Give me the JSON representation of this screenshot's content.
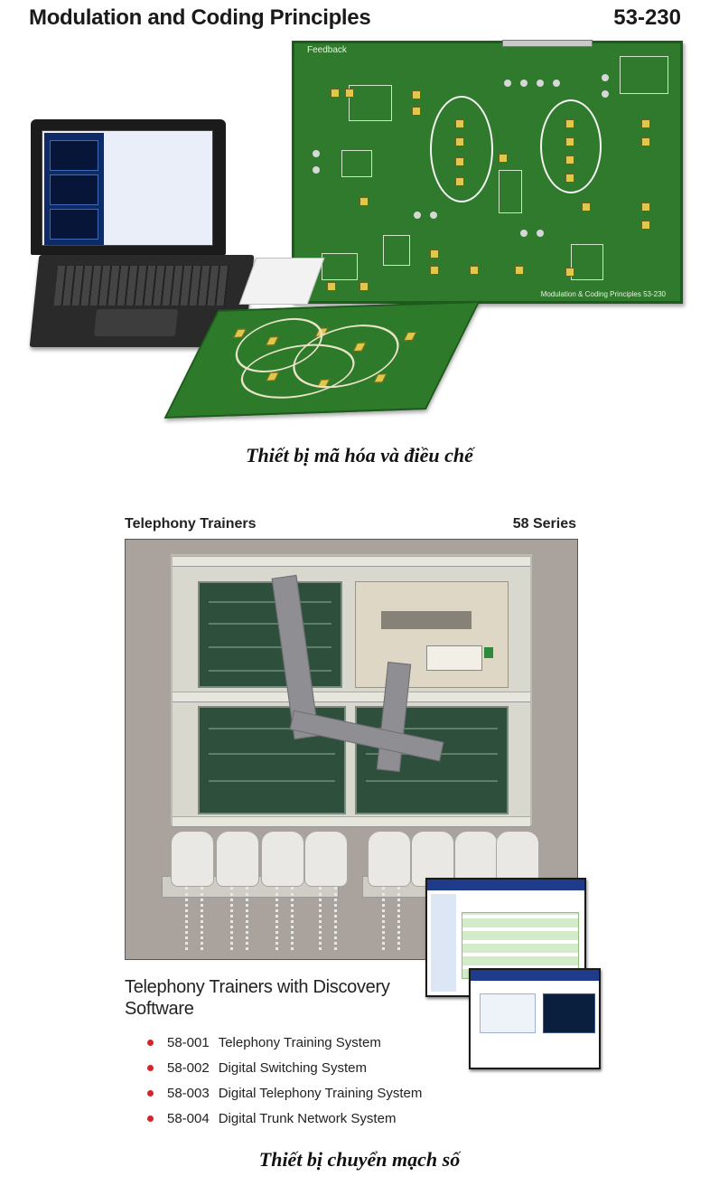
{
  "figure1": {
    "title": "Modulation and Coding Principles",
    "code": "53-230",
    "board_brand": "Feedback",
    "board_label": "Modulation & Coding Principles 53-230",
    "caption": "Thiết bị mã hóa và điều chế"
  },
  "figure2": {
    "title_left": "Telephony Trainers",
    "title_right": "58 Series",
    "description": "Telephony Trainers with Discovery Software",
    "items": [
      {
        "code": "58-001",
        "name": "Telephony Training System"
      },
      {
        "code": "58-002",
        "name": "Digital Switching System"
      },
      {
        "code": "58-003",
        "name": "Digital Telephony Training System"
      },
      {
        "code": "58-004",
        "name": "Digital Trunk Network System"
      }
    ],
    "bullet_color": "#d9232a",
    "caption": "Thiết bị chuyển mạch số"
  }
}
